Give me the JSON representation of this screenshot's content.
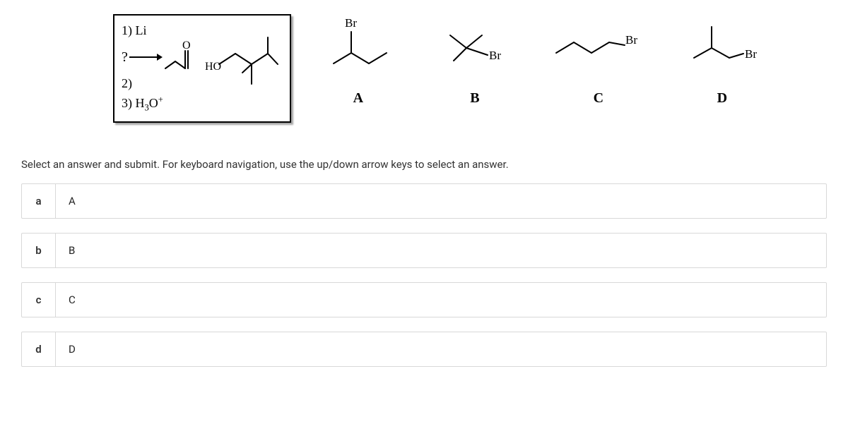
{
  "reaction": {
    "question_mark": "?",
    "step1": "1) Li",
    "step2_prefix": "2)",
    "step3_html": "3) H3O+",
    "product_HO": "HO"
  },
  "structures": {
    "A": {
      "label": "A",
      "br": "Br"
    },
    "B": {
      "label": "B",
      "br": "Br"
    },
    "C": {
      "label": "C",
      "br": "Br"
    },
    "D": {
      "label": "D",
      "br": "Br"
    }
  },
  "instructions": "Select an answer and submit. For keyboard navigation, use the up/down arrow keys to select an answer.",
  "answers": [
    {
      "key": "a",
      "label": "A"
    },
    {
      "key": "b",
      "label": "B"
    },
    {
      "key": "c",
      "label": "C"
    },
    {
      "key": "d",
      "label": "D"
    }
  ]
}
